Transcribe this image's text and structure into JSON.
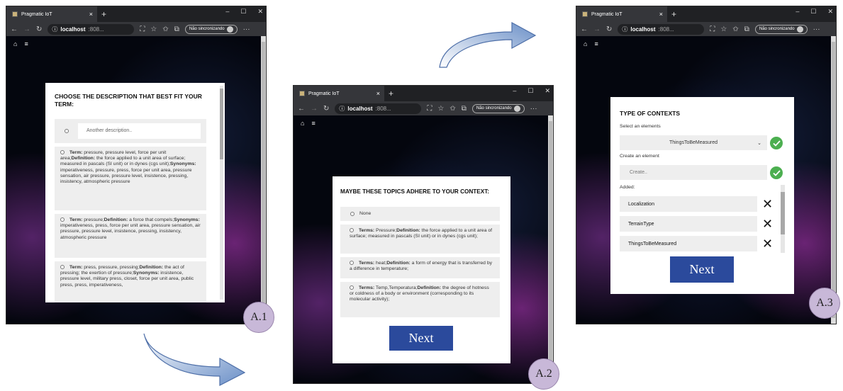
{
  "browser": {
    "tab_title": "Pragmatic IoT",
    "tab_close": "×",
    "new_tab": "+",
    "url_host": "localhost",
    "url_port": ":808...",
    "sync_label": "Não sincronizando",
    "win_min": "–",
    "win_max": "☐",
    "win_close": "✕",
    "more": "···"
  },
  "nav": {
    "home_icon": "⌂",
    "menu_icon": "≡"
  },
  "panel1": {
    "title": "CHOOSE THE DESCRIPTION THAT BEST FIT YOUR TERM:",
    "input_placeholder": "Another description..",
    "options": [
      {
        "t1": "Term:",
        "v1": " pressure, pressure level, force per unit area;",
        "t2": "Definition:",
        "v2": " the force applied to a unit area of surface; measured in pascals (SI unit) or in dynes (cgs unit);",
        "t3": "Synonyms:",
        "v3": " imperativeness, pressure, press, force per unit area, pressure sensation, air pressure, pressure level, insistence, pressing, insistency, atmospheric pressure"
      },
      {
        "t1": "Term:",
        "v1": " pressure;",
        "t2": "Definition:",
        "v2": " a force that compels;",
        "t3": "Synonyms:",
        "v3": " imperativeness, press, force per unit area, pressure sensation, air pressure, pressure level, insistence, pressing, insistency, atmospheric pressure"
      },
      {
        "t1": "Term:",
        "v1": " press, pressure, pressing;",
        "t2": "Definition:",
        "v2": " the act of pressing; the exertion of pressure;",
        "t3": "Synonyms:",
        "v3": " insistence, pressure level, military press, closet, force per unit area, public press, press, imperativeness,"
      }
    ],
    "badge": "A.1"
  },
  "panel2": {
    "title": "MAYBE THESE TOPICS ADHERE TO YOUR CONTEXT:",
    "none_label": "None",
    "options": [
      {
        "t1": "Terms:",
        "v1": " Pressure;",
        "t2": "Definition:",
        "v2": " the force applied to a unit area of surface; measured in pascals (SI unit) or in dynes (cgs unit);"
      },
      {
        "t1": "Terms:",
        "v1": " heat;",
        "t2": "Definition:",
        "v2": " a form of energy that is transferred by a difference in temperature;"
      },
      {
        "t1": "Terms:",
        "v1": " Temp,Temperatura;",
        "t2": "Definition:",
        "v2": " the degree of hotness or coldness of a body or environment (corresponding to its molecular activity);"
      }
    ],
    "next": "Next",
    "badge": "A.2"
  },
  "panel3": {
    "title": "TYPE OF CONTEXTS",
    "select_label": "Select an elements",
    "selected_value": "ThingsToBeMeasured",
    "create_label": "Create an element",
    "create_placeholder": "Create..",
    "added_label": "Added:",
    "added": [
      "Localization",
      "TerrainType",
      "ThingsToBeMeasured"
    ],
    "remove_icon": "✕",
    "next": "Next",
    "badge": "A.3"
  }
}
